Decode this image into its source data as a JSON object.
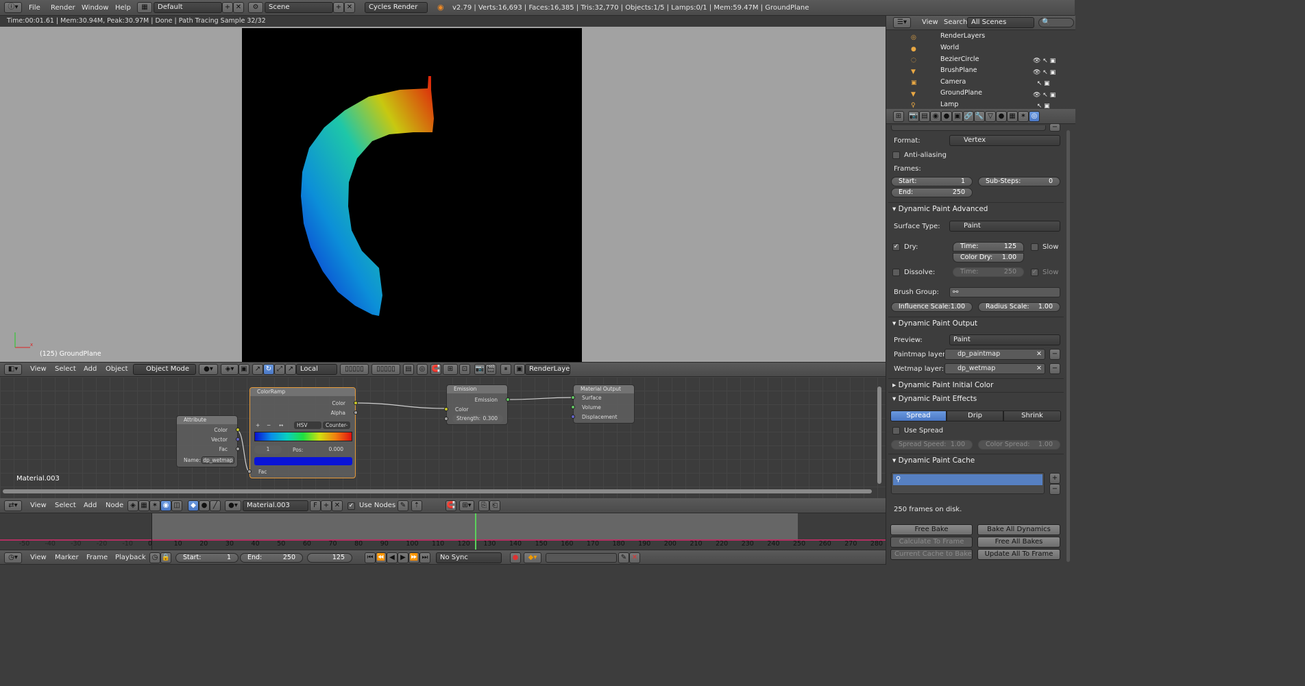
{
  "topbar": {
    "menus": [
      "File",
      "Render",
      "Window",
      "Help"
    ],
    "layout": "Default",
    "scene": "Scene",
    "engine": "Cycles Render",
    "stats": "v2.79 | Verts:16,693 | Faces:16,385 | Tris:32,770 | Objects:1/5 | Lamps:0/1 | Mem:59.47M | GroundPlane"
  },
  "viewport": {
    "render_status": "Time:00:01.61 | Mem:30.94M, Peak:30.97M | Done | Path Tracing Sample 32/32",
    "object_label": "(125) GroundPlane",
    "axis_x": "x"
  },
  "view_header": {
    "menus": [
      "View",
      "Select",
      "Add",
      "Object"
    ],
    "mode": "Object Mode",
    "orientation": "Local",
    "renderlayer": "RenderLayer"
  },
  "nodes": {
    "material_name": "Material.003",
    "attribute": {
      "title": "Attribute",
      "outputs": [
        "Color",
        "Vector",
        "Fac"
      ],
      "name_label": "Name:",
      "name_value": "dp_wetmap"
    },
    "colorramp": {
      "title": "ColorRamp",
      "outputs": [
        "Color",
        "Alpha"
      ],
      "btn_add": "+",
      "btn_remove": "−",
      "btn_flip": "↔",
      "interp_mode": "HSV",
      "hue_mode": "Counter-",
      "index": "1",
      "pos_label": "Pos:",
      "pos_value": "0.000",
      "input": "Fac",
      "selected_color": "#0a14d6"
    },
    "emission": {
      "title": "Emission",
      "output": "Emission",
      "input_color": "Color",
      "strength_label": "Strength:",
      "strength_value": "0.300"
    },
    "output": {
      "title": "Material Output",
      "inputs": [
        "Surface",
        "Volume",
        "Displacement"
      ]
    }
  },
  "node_header": {
    "menus": [
      "View",
      "Select",
      "Add",
      "Node"
    ],
    "material": "Material.003",
    "fake_user": "F",
    "use_nodes": "Use Nodes"
  },
  "timeline": {
    "ticks": [
      "-50",
      "-40",
      "-30",
      "-20",
      "-10",
      "0",
      "10",
      "20",
      "30",
      "40",
      "50",
      "60",
      "70",
      "80",
      "90",
      "100",
      "110",
      "120",
      "130",
      "140",
      "150",
      "160",
      "170",
      "180",
      "190",
      "200",
      "210",
      "220",
      "230",
      "240",
      "250",
      "260",
      "270",
      "280"
    ],
    "current_frame_value": 125,
    "menus": [
      "View",
      "Marker",
      "Frame",
      "Playback"
    ],
    "start_label": "Start:",
    "start_value": "1",
    "end_label": "End:",
    "end_value": "250",
    "current": "125",
    "sync": "No Sync"
  },
  "outliner": {
    "menus": [
      "View",
      "Search"
    ],
    "filter": "All Scenes",
    "items": [
      "RenderLayers",
      "World",
      "BezierCircle",
      "BrushPlane",
      "Camera",
      "GroundPlane",
      "Lamp"
    ]
  },
  "properties": {
    "format_label": "Format:",
    "format_value": "Vertex",
    "antialiasing": "Anti-aliasing",
    "frames_label": "Frames:",
    "start_label": "Start:",
    "start_value": "1",
    "end_label": "End:",
    "end_value": "250",
    "substeps_label": "Sub-Steps:",
    "substeps_value": "0",
    "advanced": {
      "title": "Dynamic Paint Advanced",
      "surface_label": "Surface Type:",
      "surface_value": "Paint",
      "dry": "Dry:",
      "dry_time_label": "Time:",
      "dry_time_value": "125",
      "color_dry_label": "Color Dry:",
      "color_dry_value": "1.00",
      "slow": "Slow",
      "dissolve": "Dissolve:",
      "dissolve_time_label": "Time:",
      "dissolve_time_value": "250",
      "brush_group": "Brush Group:",
      "influence_label": "Influence Scale:",
      "influence_value": "1.00",
      "radius_label": "Radius Scale:",
      "radius_value": "1.00"
    },
    "output": {
      "title": "Dynamic Paint Output",
      "preview_label": "Preview:",
      "preview_value": "Paint",
      "paintmap_label": "Paintmap layer:",
      "paintmap_value": "dp_paintmap",
      "wetmap_label": "Wetmap layer:",
      "wetmap_value": "dp_wetmap"
    },
    "initial_color": {
      "title": "Dynamic Paint Initial Color"
    },
    "effects": {
      "title": "Dynamic Paint Effects",
      "tabs": [
        "Spread",
        "Drip",
        "Shrink"
      ],
      "use_spread": "Use Spread",
      "spread_speed_label": "Spread Speed:",
      "spread_speed_value": "1.00",
      "color_spread_label": "Color Spread:",
      "color_spread_value": "1.00"
    },
    "cache": {
      "title": "Dynamic Paint Cache",
      "frames_on_disk": "250 frames on disk.",
      "free_bake": "Free Bake",
      "bake_all": "Bake All Dynamics",
      "calc_to_frame": "Calculate To Frame",
      "free_all": "Free All Bakes",
      "current_cache": "Current Cache to Bake",
      "update_all": "Update All To Frame"
    }
  }
}
